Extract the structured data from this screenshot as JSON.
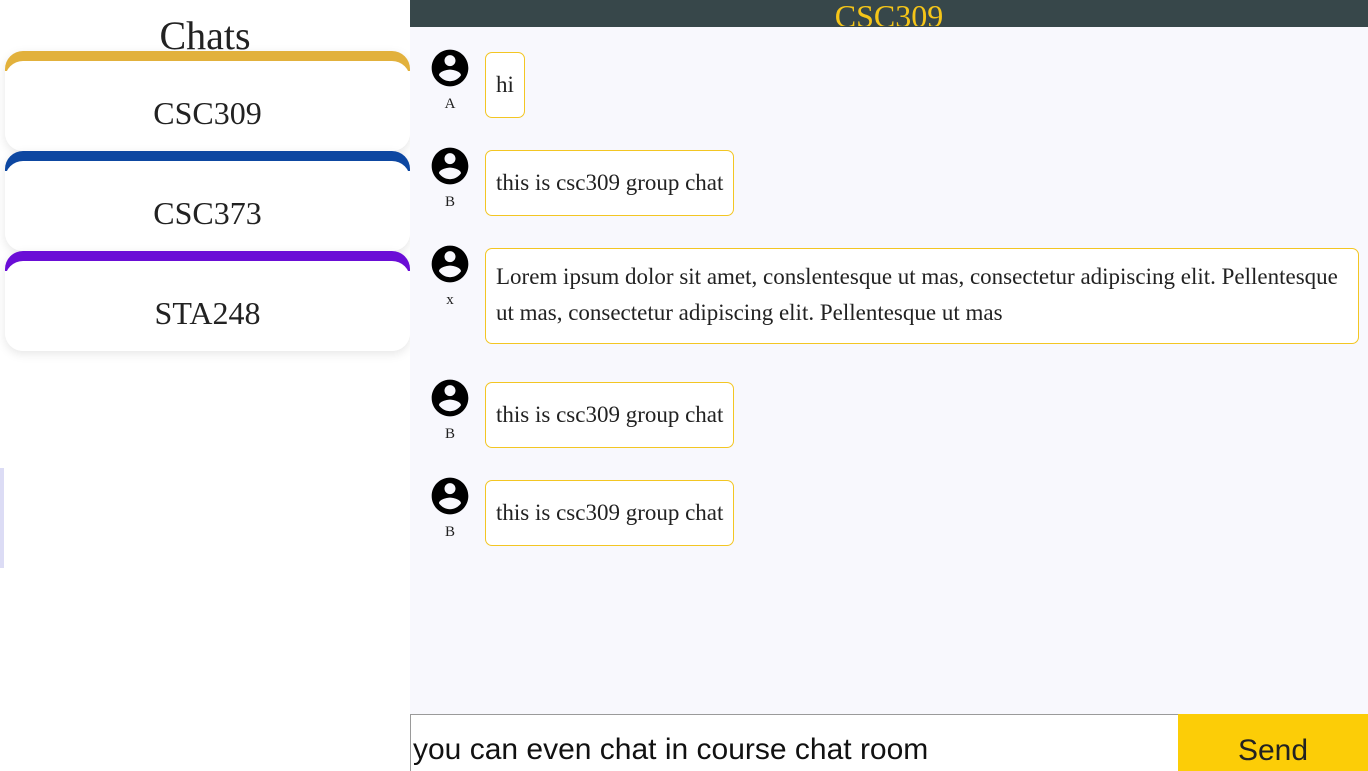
{
  "sidebar": {
    "title": "Chats",
    "items": [
      {
        "label": "CSC309",
        "color": "#e2b13c"
      },
      {
        "label": "CSC373",
        "color": "#0d47a1"
      },
      {
        "label": "STA248",
        "color": "#6a0dd6"
      }
    ]
  },
  "header": {
    "title": "CSC309",
    "background": "#37474a",
    "title_color": "#f5c518"
  },
  "messages": [
    {
      "sender": "A",
      "text": "hi",
      "avatar_icon": "account-circle-icon"
    },
    {
      "sender": "B",
      "text": "this is csc309 group chat",
      "avatar_icon": "account-circle-icon"
    },
    {
      "sender": "x",
      "text": "Lorem ipsum dolor sit amet, conslentesque ut mas, consectetur adipiscing elit. Pellentesque ut mas, consectetur adipiscing elit. Pellentesque ut mas",
      "avatar_icon": "account-circle-icon"
    },
    {
      "sender": "B",
      "text": "this is csc309 group chat",
      "avatar_icon": "account-circle-icon"
    },
    {
      "sender": "B",
      "text": "this is csc309 group chat",
      "avatar_icon": "account-circle-icon"
    }
  ],
  "composer": {
    "input_value": "you can even chat in course chat room",
    "send_label": "Send",
    "send_color": "#fccd07"
  },
  "colors": {
    "bubble_border": "#f3c623",
    "main_background": "#f8f8fd"
  }
}
